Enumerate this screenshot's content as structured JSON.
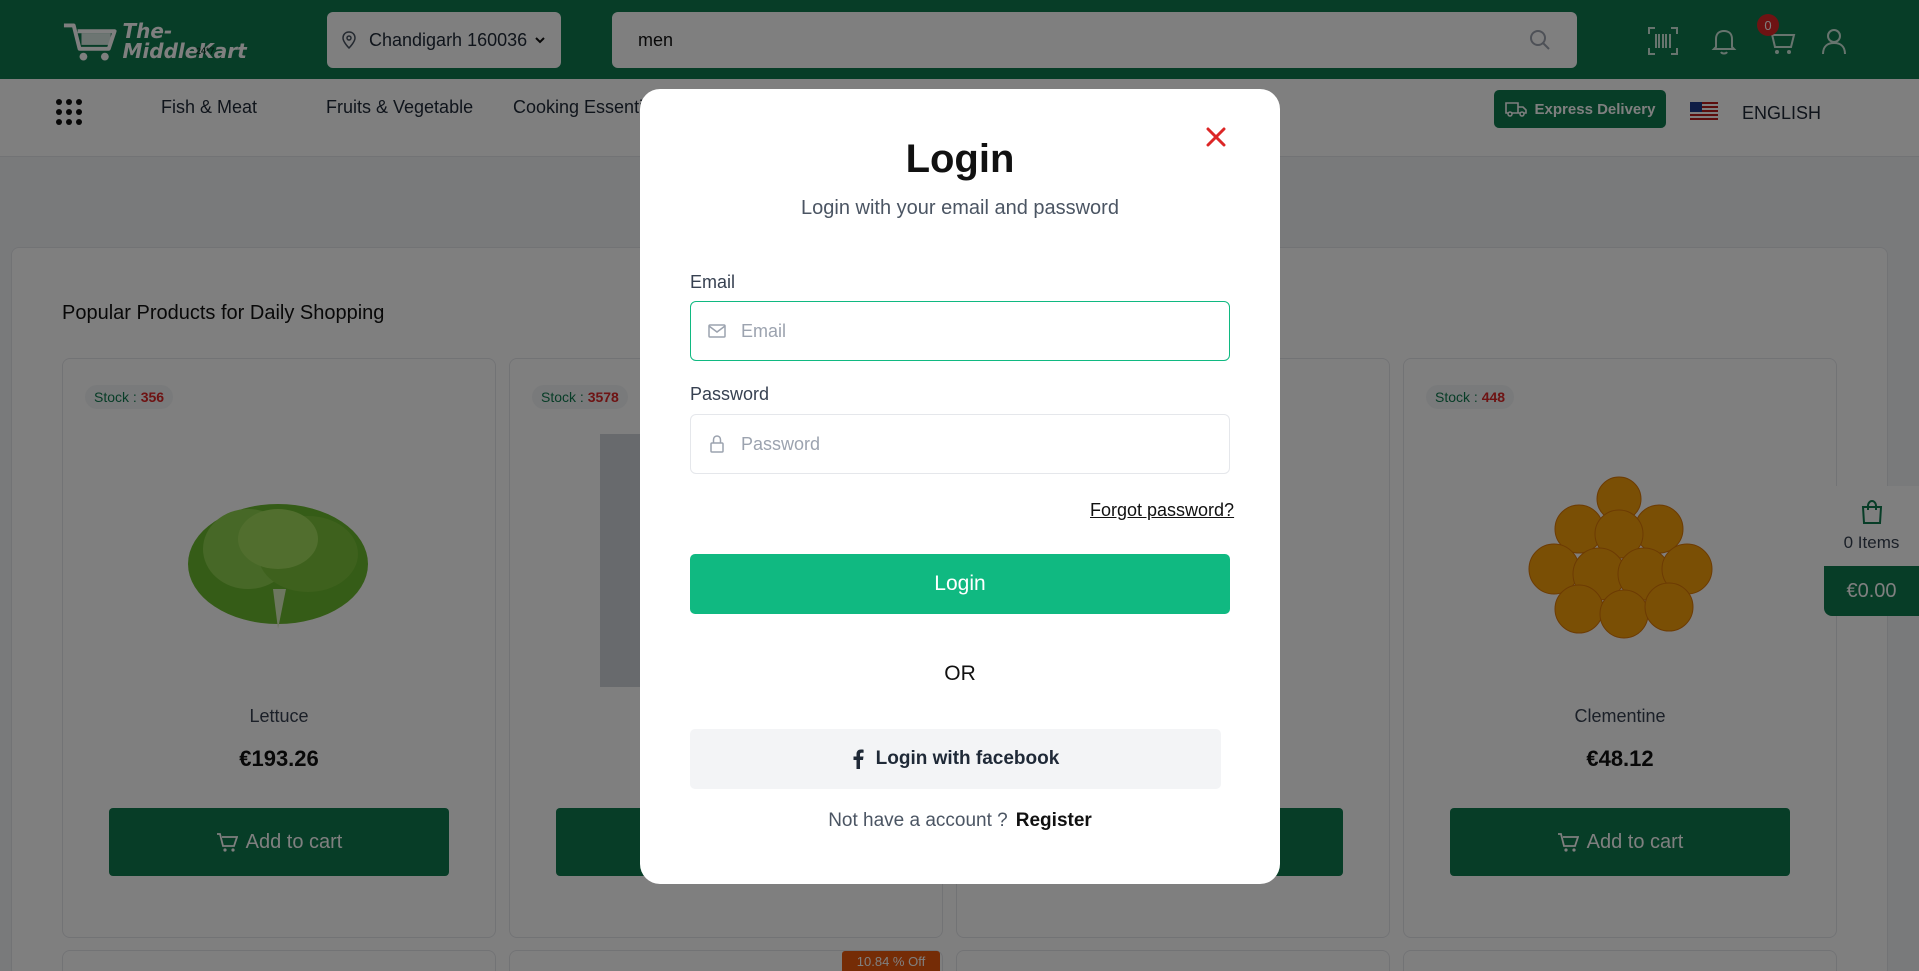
{
  "header": {
    "logo_text": "The-MiddleKart",
    "logo_sub": "24*7",
    "location": "Chandigarh 160036",
    "search_value": "men",
    "cart_count": "0"
  },
  "nav": {
    "links": [
      "Fish & Meat",
      "Fruits & Vegetable",
      "Cooking Essenti"
    ],
    "express": "Express Delivery",
    "language": "ENGLISH"
  },
  "section": {
    "title": "Popular Products for Daily Shopping"
  },
  "products": [
    {
      "stock_label": "Stock :",
      "stock": "356",
      "name": "Lettuce",
      "price": "€193.26",
      "cta": "Add to cart"
    },
    {
      "stock_label": "Stock :",
      "stock": "3578",
      "name": "",
      "price": "",
      "cta": ""
    },
    {
      "stock_label": "",
      "stock": "",
      "name": "",
      "price": "",
      "cta": ""
    },
    {
      "stock_label": "Stock :",
      "stock": "448",
      "name": "Clementine",
      "price": "€48.12",
      "cta": "Add to cart"
    }
  ],
  "discount_badge": "10.84 % Off",
  "side_cart": {
    "items": "0 Items",
    "total": "€0.00"
  },
  "modal": {
    "title": "Login",
    "subtitle": "Login with your email and password",
    "email_label": "Email",
    "email_placeholder": "Email",
    "password_label": "Password",
    "password_placeholder": "Password",
    "forgot": "Forgot password?",
    "login_button": "Login",
    "or": "OR",
    "facebook_button": "Login with facebook",
    "no_account": "Not have a account ?",
    "register": "Register"
  },
  "colors": {
    "brand": "#0f7a4e",
    "accent": "#10b981",
    "danger": "#dc2626"
  }
}
